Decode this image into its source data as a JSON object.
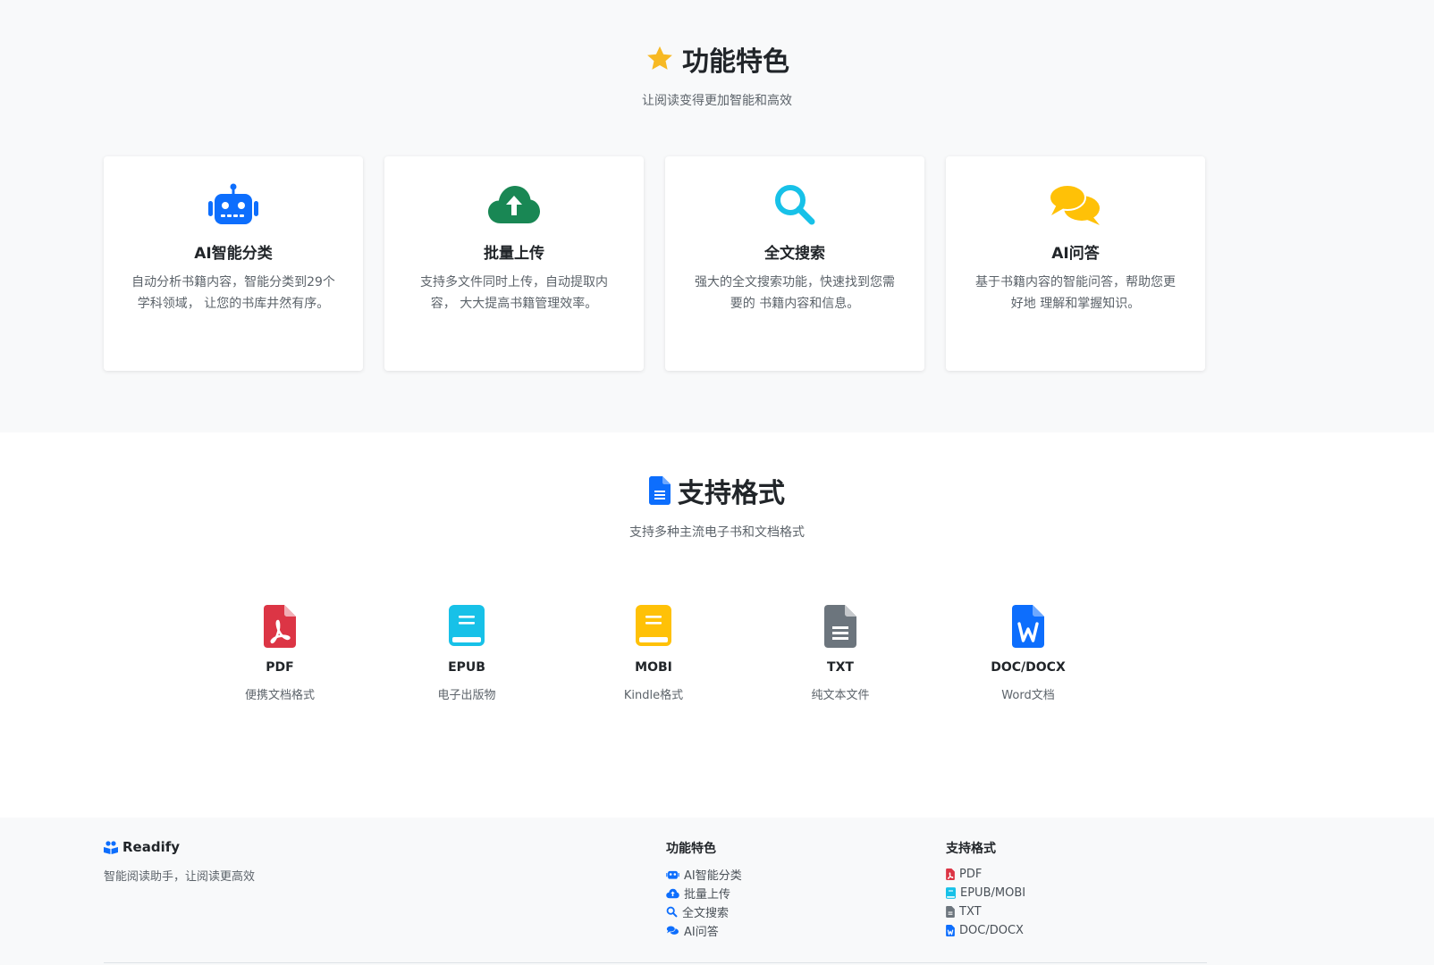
{
  "colors": {
    "star": "#f7b924",
    "primary": "#0d6efd",
    "success": "#198754",
    "info": "#17c1e8",
    "warning": "#ffc107",
    "danger": "#dc3545",
    "secondary": "#6c757d"
  },
  "features": {
    "icon": "star-icon",
    "title": "功能特色",
    "subtitle": "让阅读变得更加智能和高效",
    "cards": [
      {
        "icon": "robot-icon",
        "title": "AI智能分类",
        "desc": "自动分析书籍内容，智能分类到29个学科领域， 让您的书库井然有序。"
      },
      {
        "icon": "cloud-upload-icon",
        "title": "批量上传",
        "desc": "支持多文件同时上传，自动提取内容， 大大提高书籍管理效率。"
      },
      {
        "icon": "search-icon",
        "title": "全文搜索",
        "desc": "强大的全文搜索功能，快速找到您需要的 书籍内容和信息。"
      },
      {
        "icon": "chat-icon",
        "title": "AI问答",
        "desc": "基于书籍内容的智能问答，帮助您更好地 理解和掌握知识。"
      }
    ]
  },
  "formats": {
    "icon": "file-text-icon",
    "title": "支持格式",
    "subtitle": "支持多种主流电子书和文档格式",
    "items": [
      {
        "icon": "file-pdf-icon",
        "name": "PDF",
        "desc": "便携文档格式"
      },
      {
        "icon": "book-icon",
        "name": "EPUB",
        "desc": "电子出版物"
      },
      {
        "icon": "book-icon",
        "name": "MOBI",
        "desc": "Kindle格式"
      },
      {
        "icon": "file-text-icon",
        "name": "TXT",
        "desc": "纯文本文件"
      },
      {
        "icon": "file-word-icon",
        "name": "DOC/DOCX",
        "desc": "Word文档"
      }
    ]
  },
  "footer": {
    "brand": "Readify",
    "tagline": "智能阅读助手，让阅读更高效",
    "col1": {
      "title": "功能特色",
      "items": [
        {
          "icon": "robot-icon",
          "label": "AI智能分类"
        },
        {
          "icon": "cloud-upload-icon",
          "label": "批量上传"
        },
        {
          "icon": "search-icon",
          "label": "全文搜索"
        },
        {
          "icon": "chat-icon",
          "label": "AI问答"
        }
      ]
    },
    "col2": {
      "title": "支持格式",
      "items": [
        {
          "icon": "file-pdf-icon",
          "label": "PDF"
        },
        {
          "icon": "book-icon",
          "label": "EPUB/MOBI"
        },
        {
          "icon": "file-text-icon",
          "label": "TXT"
        },
        {
          "icon": "file-word-icon",
          "label": "DOC/DOCX"
        }
      ]
    }
  }
}
